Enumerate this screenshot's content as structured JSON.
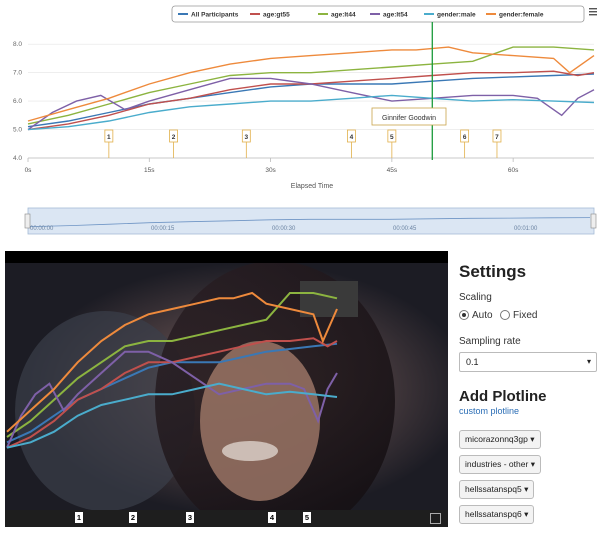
{
  "legend": [
    {
      "label": "All Participants",
      "color": "#3a78b5"
    },
    {
      "label": "age:gt55",
      "color": "#c0504d"
    },
    {
      "label": "age:lt44",
      "color": "#8cb440"
    },
    {
      "label": "age:lt54",
      "color": "#7e60a7"
    },
    {
      "label": "gender:male",
      "color": "#4aaccc"
    },
    {
      "label": "gender:female",
      "color": "#ee8a3c"
    }
  ],
  "chart_data": {
    "type": "line",
    "xlabel": "Elapsed Time",
    "ylabel": "",
    "xlim": [
      0,
      70
    ],
    "ylim": [
      4.0,
      8.5
    ],
    "x_ticks": [
      "0s",
      "15s",
      "30s",
      "45s",
      "60s"
    ],
    "y_ticks": [
      "4.0",
      "5.0",
      "6.0",
      "7.0",
      "8.0"
    ],
    "cursor_x": 50,
    "markers": [
      {
        "label": "1",
        "x": 10
      },
      {
        "label": "2",
        "x": 18
      },
      {
        "label": "3",
        "x": 27
      },
      {
        "label": "4",
        "x": 40
      },
      {
        "label": "5",
        "x": 45
      },
      {
        "label": "6",
        "x": 54
      },
      {
        "label": "7",
        "x": 58
      }
    ],
    "tooltip": "Ginnifer Goodwin",
    "series": [
      {
        "name": "All Participants",
        "color": "#3a78b5",
        "x": [
          0,
          5,
          10,
          15,
          20,
          25,
          30,
          35,
          40,
          45,
          50,
          55,
          60,
          65,
          70
        ],
        "y": [
          5.1,
          5.3,
          5.6,
          5.9,
          6.1,
          6.3,
          6.5,
          6.6,
          6.6,
          6.6,
          6.7,
          6.8,
          6.85,
          6.9,
          6.95
        ]
      },
      {
        "name": "age:gt55",
        "color": "#c0504d",
        "x": [
          0,
          5,
          10,
          15,
          20,
          25,
          30,
          35,
          40,
          45,
          50,
          55,
          60,
          65,
          68,
          70
        ],
        "y": [
          5.0,
          5.2,
          5.5,
          5.9,
          6.1,
          6.4,
          6.6,
          6.6,
          6.7,
          6.8,
          6.9,
          7.0,
          7.0,
          7.05,
          6.9,
          7.0
        ]
      },
      {
        "name": "age:lt44",
        "color": "#8cb440",
        "x": [
          0,
          5,
          10,
          15,
          20,
          25,
          30,
          35,
          40,
          45,
          50,
          55,
          60,
          65,
          70
        ],
        "y": [
          5.2,
          5.5,
          5.9,
          6.3,
          6.6,
          6.9,
          7.0,
          7.0,
          7.1,
          7.2,
          7.3,
          7.4,
          7.9,
          7.9,
          7.8
        ]
      },
      {
        "name": "age:lt54",
        "color": "#7e60a7",
        "x": [
          0,
          3,
          6,
          9,
          12,
          15,
          20,
          25,
          30,
          35,
          40,
          45,
          50,
          55,
          60,
          63,
          66,
          68,
          70
        ],
        "y": [
          5.0,
          5.6,
          6.0,
          6.2,
          5.7,
          6.0,
          6.4,
          6.8,
          6.8,
          6.6,
          6.3,
          6.0,
          6.1,
          6.2,
          6.2,
          6.1,
          5.5,
          6.1,
          6.4
        ]
      },
      {
        "name": "gender:male",
        "color": "#4aaccc",
        "x": [
          0,
          5,
          10,
          15,
          20,
          25,
          30,
          35,
          40,
          45,
          50,
          55,
          60,
          65,
          70
        ],
        "y": [
          5.0,
          5.1,
          5.3,
          5.6,
          5.8,
          5.9,
          6.0,
          6.0,
          6.1,
          6.2,
          6.1,
          6.0,
          6.05,
          6.0,
          5.95
        ]
      },
      {
        "name": "gender:female",
        "color": "#ee8a3c",
        "x": [
          0,
          5,
          10,
          15,
          20,
          25,
          30,
          35,
          40,
          45,
          48,
          52,
          55,
          60,
          65,
          67,
          70
        ],
        "y": [
          5.3,
          5.7,
          6.1,
          6.6,
          7.0,
          7.3,
          7.5,
          7.6,
          7.7,
          7.8,
          7.8,
          7.9,
          7.7,
          7.6,
          7.5,
          7.0,
          7.6
        ]
      }
    ]
  },
  "navigator": {
    "ticks": [
      "00:00:00",
      "00:00:15",
      "00:00:30",
      "00:00:45",
      "00:01:00"
    ]
  },
  "video": {
    "markers": [
      "1",
      "2",
      "3",
      "4",
      "5"
    ]
  },
  "settings": {
    "title": "Settings",
    "scaling_label": "Scaling",
    "scaling_options": [
      "Auto",
      "Fixed"
    ],
    "scaling_selected": "Auto",
    "sampling_label": "Sampling rate",
    "sampling_value": "0.1",
    "add_title": "Add Plotline",
    "custom_link": "custom plotline",
    "plotline_buttons": [
      "micorazonnq3gp",
      "industries - other",
      "hellssatanspq5",
      "hellssatanspq6"
    ]
  }
}
